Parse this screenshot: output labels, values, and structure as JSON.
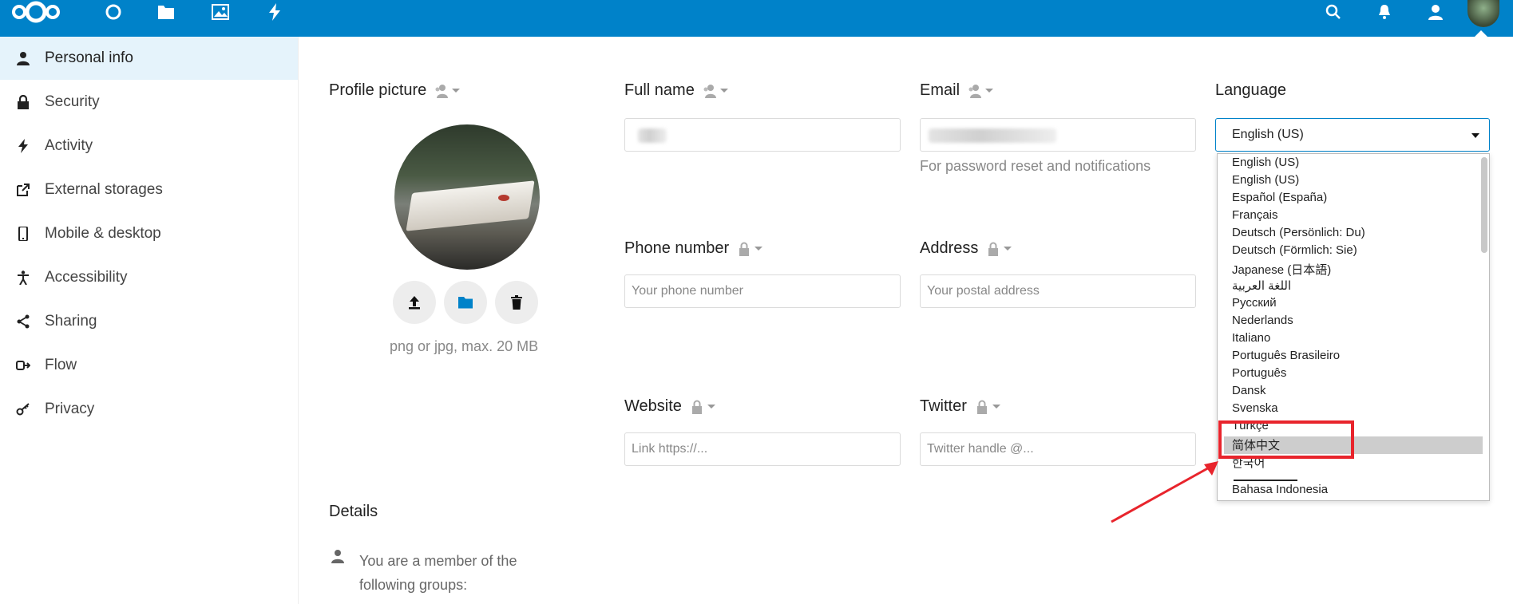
{
  "nav": {
    "icons": [
      "nextcloud-logo",
      "dashboard-icon",
      "files-icon",
      "photos-icon",
      "activity-icon"
    ],
    "right_icons": [
      "search-icon",
      "notifications-icon",
      "contacts-icon",
      "avatar"
    ]
  },
  "sidebar": {
    "items": [
      {
        "label": "Personal info",
        "icon": "person-icon",
        "active": true
      },
      {
        "label": "Security",
        "icon": "lock-icon"
      },
      {
        "label": "Activity",
        "icon": "bolt-icon"
      },
      {
        "label": "External storages",
        "icon": "external-link-icon"
      },
      {
        "label": "Mobile & desktop",
        "icon": "phone-icon"
      },
      {
        "label": "Accessibility",
        "icon": "accessibility-icon"
      },
      {
        "label": "Sharing",
        "icon": "share-icon"
      },
      {
        "label": "Flow",
        "icon": "flow-icon"
      },
      {
        "label": "Privacy",
        "icon": "key-icon"
      }
    ]
  },
  "profile": {
    "title": "Profile picture",
    "hint": "png or jpg, max. 20 MB",
    "buttons": [
      "upload-icon",
      "folder-icon",
      "delete-icon"
    ]
  },
  "fields": {
    "full_name": {
      "label": "Full name",
      "value": ""
    },
    "email": {
      "label": "Email",
      "value": "",
      "hint": "For password reset and notifications"
    },
    "language": {
      "label": "Language",
      "selected": "English (US)"
    },
    "phone": {
      "label": "Phone number",
      "placeholder": "Your phone number"
    },
    "address": {
      "label": "Address",
      "placeholder": "Your postal address"
    },
    "website": {
      "label": "Website",
      "placeholder": "Link https://..."
    },
    "twitter": {
      "label": "Twitter",
      "placeholder": "Twitter handle @..."
    }
  },
  "language_options": [
    "English (US)",
    "English (US)",
    "Español (España)",
    "Français",
    "Deutsch (Persönlich: Du)",
    "Deutsch (Förmlich: Sie)",
    "Japanese (日本語)",
    "اللغة العربية",
    "Русский",
    "Nederlands",
    "Italiano",
    "Português Brasileiro",
    "Português",
    "Dansk",
    "Svenska",
    "Türkçe",
    "简体中文",
    "한국어",
    "Bahasa Indonesia"
  ],
  "highlighted_option": "简体中文",
  "details": {
    "title": "Details",
    "groups_text_line1": "You are a member of the",
    "groups_text_line2": "following groups:"
  },
  "colors": {
    "header": "#0082c9",
    "annotation": "#e8242c"
  }
}
